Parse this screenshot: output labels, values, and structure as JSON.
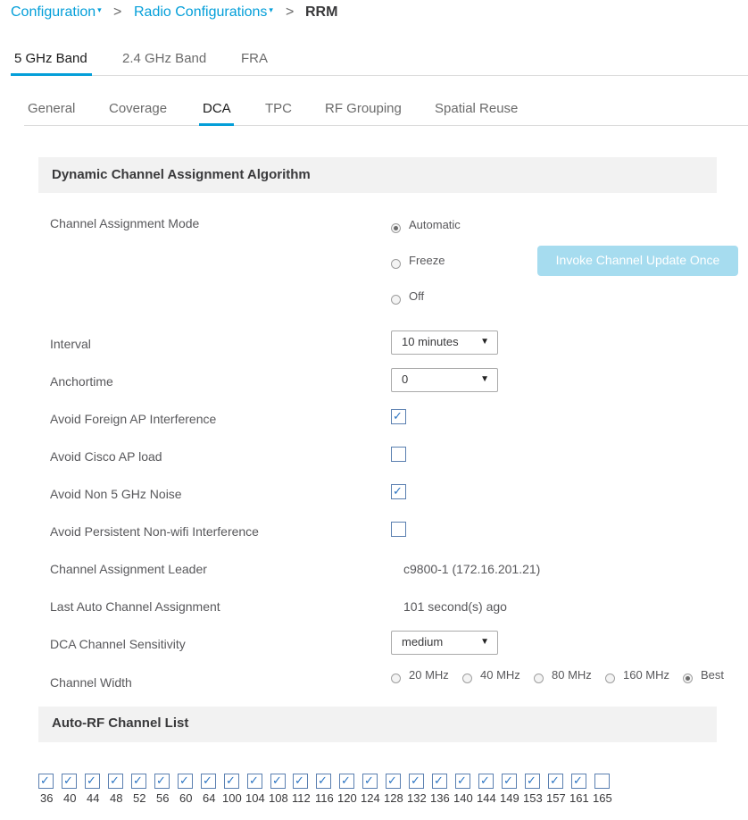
{
  "breadcrumb": {
    "items": [
      "Configuration",
      "Radio Configurations"
    ],
    "current": "RRM",
    "separator": ">",
    "caret": "▾"
  },
  "band_tabs": [
    "5 GHz Band",
    "2.4 GHz Band",
    "FRA"
  ],
  "sub_tabs": [
    "General",
    "Coverage",
    "DCA",
    "TPC",
    "RF Grouping",
    "Spatial Reuse"
  ],
  "active_band_tab": "5 GHz Band",
  "active_sub_tab": "DCA",
  "dca": {
    "section_title": "Dynamic Channel Assignment Algorithm",
    "mode_label": "Channel Assignment Mode",
    "modes": [
      "Automatic",
      "Freeze",
      "Off"
    ],
    "selected_mode": "Automatic",
    "invoke_button": "Invoke Channel Update Once",
    "interval_label": "Interval",
    "interval_value": "10 minutes",
    "anchortime_label": "Anchortime",
    "anchortime_value": "0",
    "avoid_foreign_label": "Avoid Foreign AP Interference",
    "avoid_foreign_checked": true,
    "avoid_cisco_label": "Avoid Cisco AP load",
    "avoid_cisco_checked": false,
    "avoid_non5_label": "Avoid Non 5 GHz Noise",
    "avoid_non5_checked": true,
    "avoid_persistent_label": "Avoid Persistent Non-wifi Interference",
    "avoid_persistent_checked": false,
    "leader_label": "Channel Assignment Leader",
    "leader_value": "c9800-1 (172.16.201.21)",
    "last_auto_label": "Last Auto Channel Assignment",
    "last_auto_value": "101 second(s) ago",
    "sensitivity_label": "DCA Channel Sensitivity",
    "sensitivity_value": "medium",
    "width_label": "Channel Width",
    "widths": [
      "20 MHz",
      "40 MHz",
      "80 MHz",
      "160 MHz",
      "Best"
    ],
    "selected_width": "Best"
  },
  "auto_rf": {
    "section_title": "Auto-RF Channel List",
    "channels": [
      {
        "num": "36",
        "checked": true
      },
      {
        "num": "40",
        "checked": true
      },
      {
        "num": "44",
        "checked": true
      },
      {
        "num": "48",
        "checked": true
      },
      {
        "num": "52",
        "checked": true
      },
      {
        "num": "56",
        "checked": true
      },
      {
        "num": "60",
        "checked": true
      },
      {
        "num": "64",
        "checked": true
      },
      {
        "num": "100",
        "checked": true
      },
      {
        "num": "104",
        "checked": true
      },
      {
        "num": "108",
        "checked": true
      },
      {
        "num": "112",
        "checked": true
      },
      {
        "num": "116",
        "checked": true
      },
      {
        "num": "120",
        "checked": true
      },
      {
        "num": "124",
        "checked": true
      },
      {
        "num": "128",
        "checked": true
      },
      {
        "num": "132",
        "checked": true
      },
      {
        "num": "136",
        "checked": true
      },
      {
        "num": "140",
        "checked": true
      },
      {
        "num": "144",
        "checked": true
      },
      {
        "num": "149",
        "checked": true
      },
      {
        "num": "153",
        "checked": true
      },
      {
        "num": "157",
        "checked": true
      },
      {
        "num": "161",
        "checked": true
      },
      {
        "num": "165",
        "checked": false
      }
    ]
  },
  "icons": {
    "check": "✓",
    "dropdown": "▼"
  },
  "colors": {
    "accent": "#049fd9",
    "button_disabled": "#a6dcef",
    "section_bg": "#f2f2f2"
  }
}
